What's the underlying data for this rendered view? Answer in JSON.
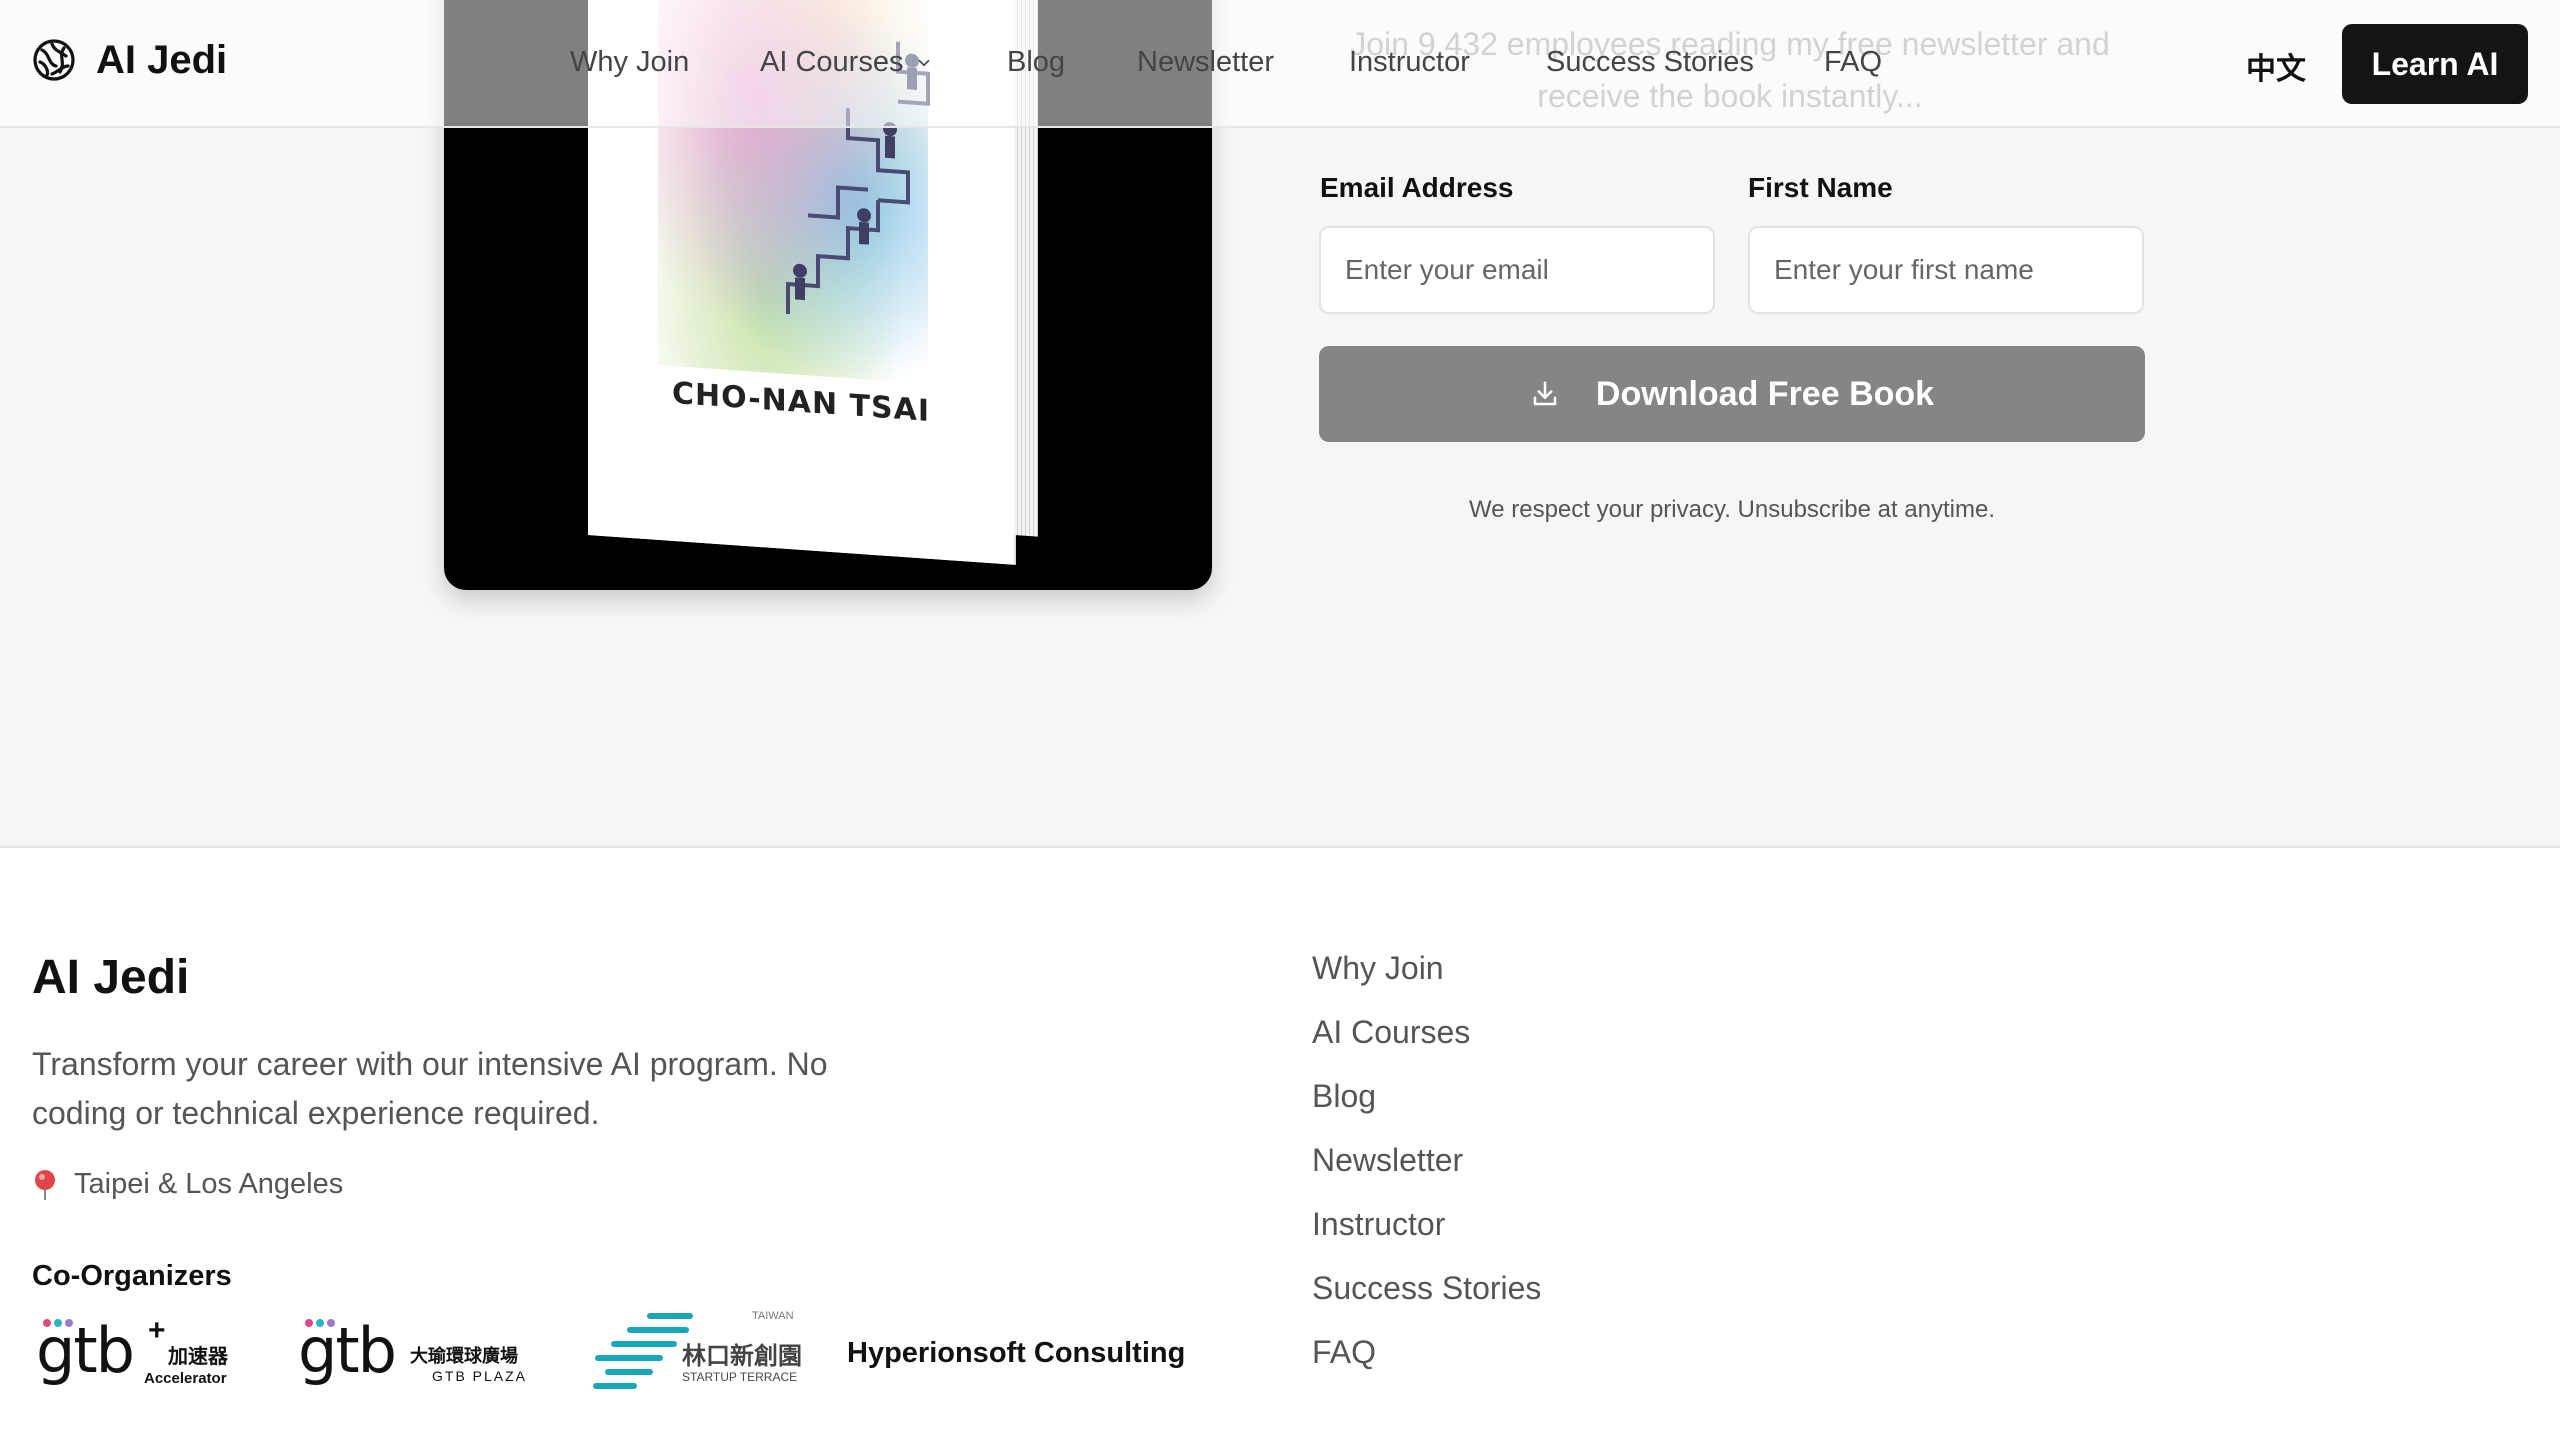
{
  "header": {
    "brand": "AI Jedi",
    "nav": [
      {
        "label": "Why Join"
      },
      {
        "label": "AI Courses"
      },
      {
        "label": "Blog"
      },
      {
        "label": "Newsletter"
      },
      {
        "label": "Instructor"
      },
      {
        "label": "Success Stories"
      },
      {
        "label": "FAQ"
      }
    ],
    "language_label": "中文",
    "cta_label": "Learn AI"
  },
  "book": {
    "author": "CHO-NAN TSAI"
  },
  "newsletter_form": {
    "intro": "Join 9,432 employees reading my free newsletter and receive the book instantly...",
    "email_label": "Email Address",
    "email_placeholder": "Enter your email",
    "firstname_label": "First Name",
    "firstname_placeholder": "Enter your first name",
    "submit_label": "Download Free Book",
    "privacy_note": "We respect your privacy. Unsubscribe at anytime."
  },
  "footer": {
    "brand": "AI Jedi",
    "description": "Transform your career with our intensive AI program. No coding or technical experience required.",
    "location": "Taipei & Los Angeles",
    "co_organizers_title": "Co-Organizers",
    "organizers": {
      "gtb_accelerator": {
        "word": "gtb",
        "cjk": "加速器",
        "sub": "Accelerator"
      },
      "gtb_plaza": {
        "word": "gtb",
        "cjk": "大瑜環球廣場",
        "sub": "GTB PLAZA"
      },
      "startup_terrace": {
        "cjk": "林口新創園",
        "sub": "STARTUP TERRACE",
        "tag": "TAIWAN"
      },
      "hyperionsoft": "Hyperionsoft Consulting"
    },
    "links": [
      {
        "label": "Why Join"
      },
      {
        "label": "AI Courses"
      },
      {
        "label": "Blog"
      },
      {
        "label": "Newsletter"
      },
      {
        "label": "Instructor"
      },
      {
        "label": "Success Stories"
      },
      {
        "label": "FAQ"
      }
    ]
  },
  "colors": {
    "accent_dark": "#141414",
    "button_disabled": "#858585",
    "section_bg": "#f6f6f6",
    "startup_terrace_teal": "#1aa6b7"
  },
  "icons": [
    "brain-logo-icon",
    "chevron-down-icon",
    "download-icon",
    "location-pin-icon"
  ]
}
